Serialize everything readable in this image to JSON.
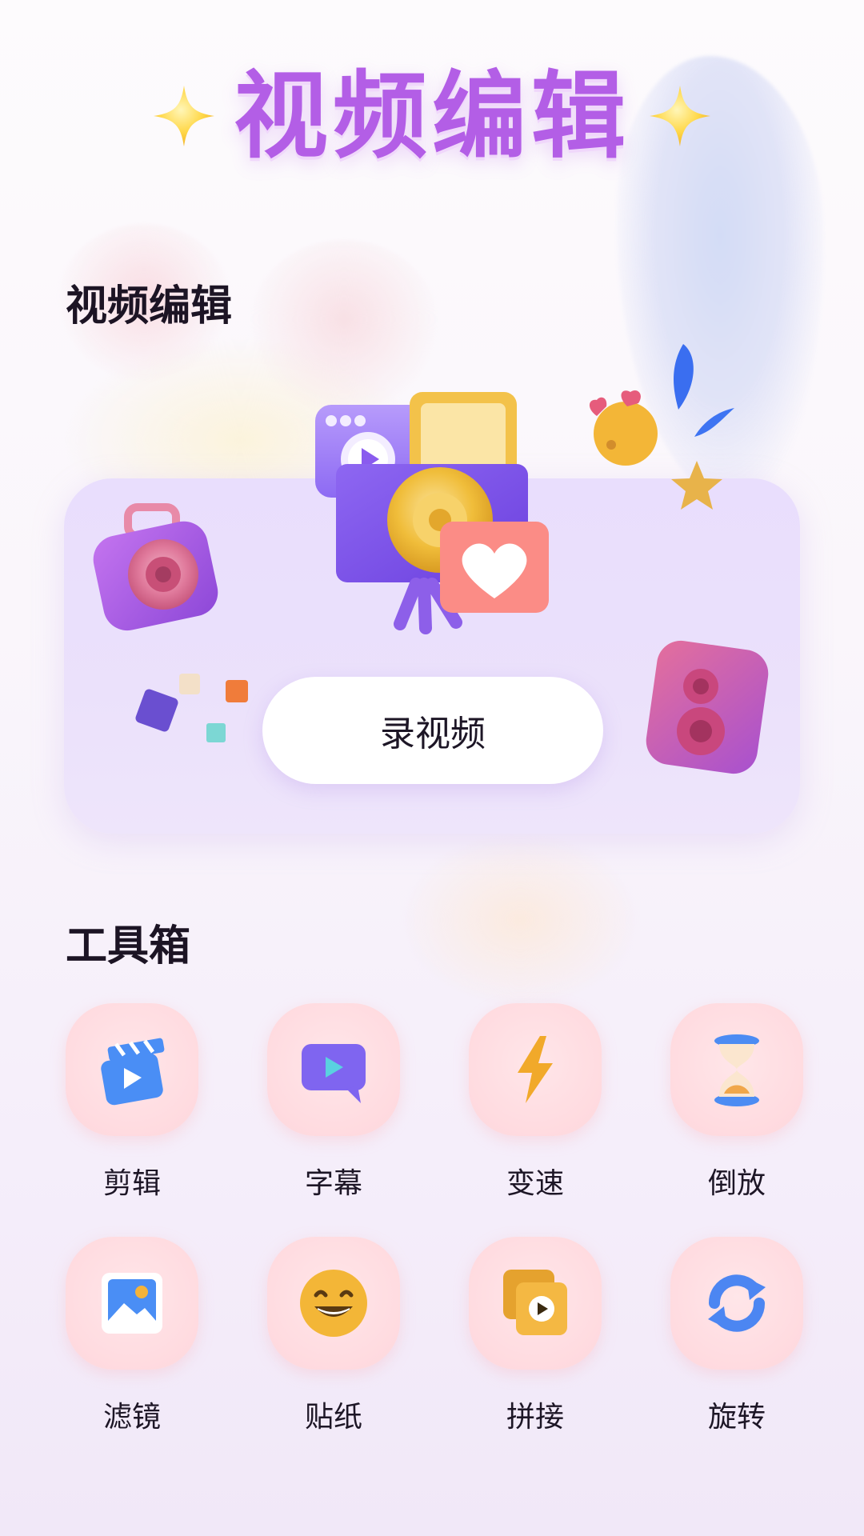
{
  "header": {
    "banner_title": "视频编辑"
  },
  "video_section": {
    "title": "视频编辑",
    "record_button_label": "录视频"
  },
  "tools_section": {
    "title": "工具箱",
    "items": [
      {
        "label": "剪辑",
        "icon": "clapperboard-play-icon"
      },
      {
        "label": "字幕",
        "icon": "subtitle-bubble-icon"
      },
      {
        "label": "变速",
        "icon": "lightning-icon"
      },
      {
        "label": "倒放",
        "icon": "hourglass-icon"
      },
      {
        "label": "滤镜",
        "icon": "picture-frame-icon"
      },
      {
        "label": "贴纸",
        "icon": "smiley-face-icon"
      },
      {
        "label": "拼接",
        "icon": "stacked-play-icon"
      },
      {
        "label": "旋转",
        "icon": "rotate-arrows-icon"
      }
    ]
  },
  "colors": {
    "brand_purple": "#b35ee6",
    "card_background": "#ebe1fb",
    "tool_tile": "#ffdbe0",
    "text_dark": "#1c1424"
  }
}
